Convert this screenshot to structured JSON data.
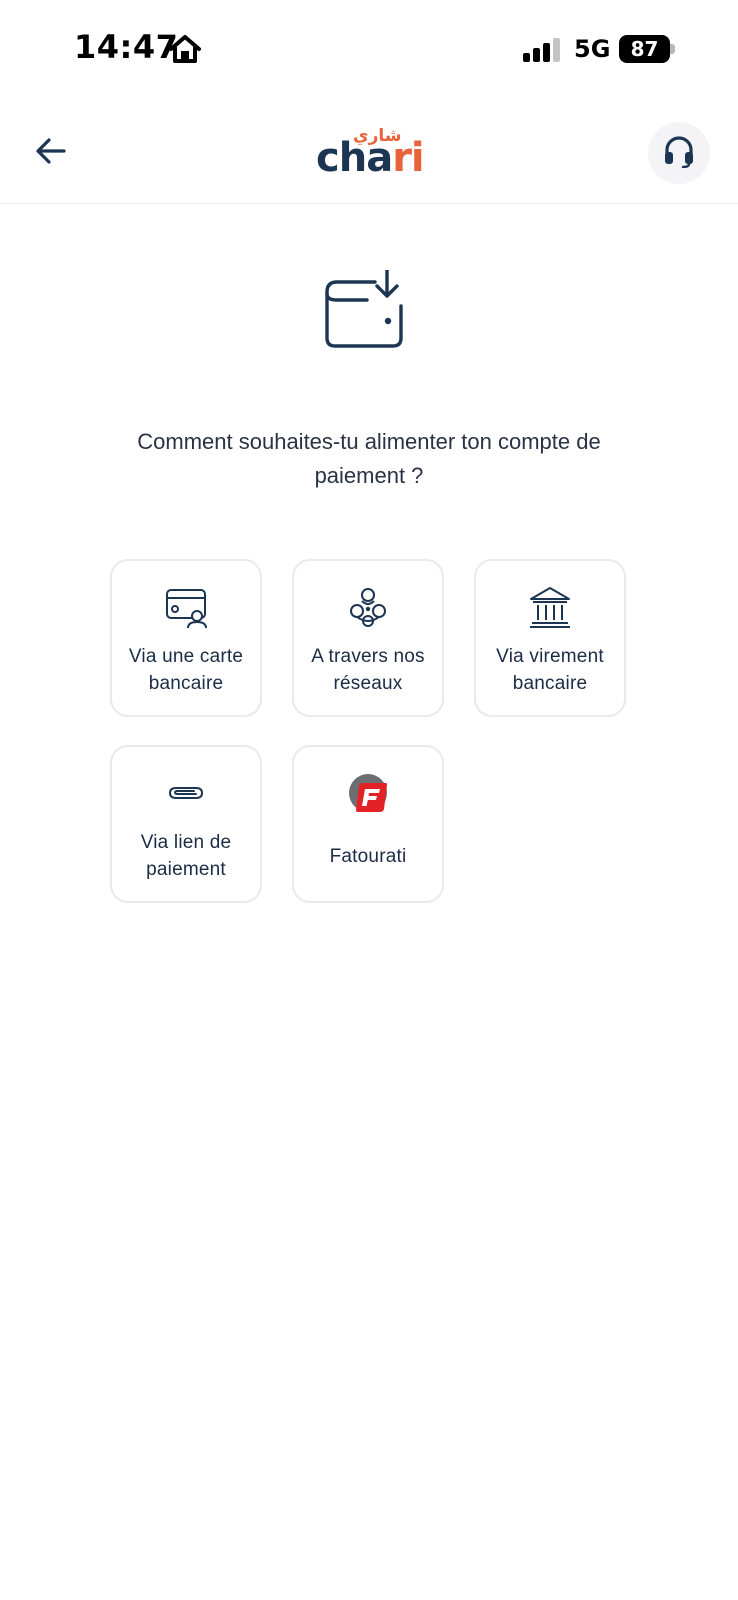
{
  "status_bar": {
    "time": "14:47",
    "network": "5G",
    "battery": "87",
    "icons": [
      "home-icon",
      "signal-icon",
      "battery-icon"
    ]
  },
  "header": {
    "logo_arabic": "شاري",
    "logo_latin_main": "cha",
    "logo_latin_accent": "ri",
    "back_icon": "arrow-left-icon",
    "support_icon": "headset-icon"
  },
  "colors": {
    "brand_navy": "#1c3552",
    "brand_orange": "#e8633a",
    "fatourati_red": "#e32228",
    "fatourati_grey": "#6d6e71",
    "card_border": "#e9e9ee"
  },
  "main": {
    "hero_icon": "wallet-download-icon",
    "prompt": "Comment souhaites-tu alimenter ton compte de paiement ?",
    "options": [
      {
        "label": "Via une carte bancaire",
        "icon": "card-user-icon"
      },
      {
        "label": "A travers nos réseaux",
        "icon": "network-icon"
      },
      {
        "label": "Via virement bancaire",
        "icon": "bank-icon"
      },
      {
        "label": "Via lien de paiement",
        "icon": "paperclip-icon"
      },
      {
        "label": "Fatourati",
        "icon": "fatourati-logo-icon"
      }
    ]
  }
}
